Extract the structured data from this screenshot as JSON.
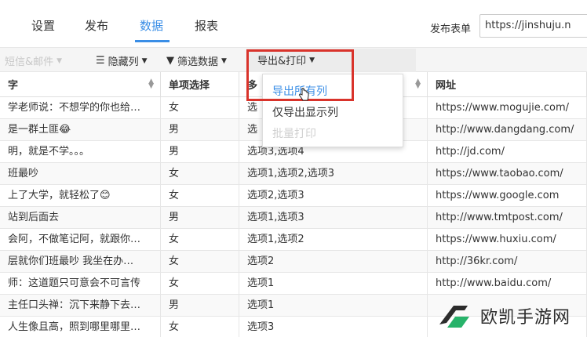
{
  "tabs": [
    {
      "label": "设置"
    },
    {
      "label": "发布"
    },
    {
      "label": "数据"
    },
    {
      "label": "报表"
    }
  ],
  "publish": {
    "label": "发布表单",
    "url": "https://jinshuju.n"
  },
  "toolbar": {
    "faded_label": "短信&邮件",
    "hide_columns": "隐藏列",
    "filter_data": "筛选数据",
    "export_print": "导出&打印"
  },
  "table": {
    "headers": [
      "字",
      "单项选择",
      "多",
      "网址"
    ],
    "rows": [
      [
        "学老师说：不想学的你也给…",
        "女",
        "选",
        "https://www.mogujie.com/"
      ],
      [
        "是一群土匪😂",
        "男",
        "选",
        "http://www.dangdang.com/"
      ],
      [
        "明，就是不学。。。",
        "男",
        "选项3,选项4",
        "http://jd.com/"
      ],
      [
        "班最吵",
        "女",
        "选项1,选项2,选项3",
        "https://www.taobao.com/"
      ],
      [
        "上了大学，就轻松了😊",
        "女",
        "选项2,选项3",
        "https://www.google.com"
      ],
      [
        "站到后面去",
        "男",
        "选项1,选项3",
        "http://www.tmtpost.com/"
      ],
      [
        "会阿，不做笔记阿，就跟你…",
        "女",
        "选项1,选项2",
        "https://www.huxiu.com/"
      ],
      [
        "层就你们班最吵 我坐在办…",
        "女",
        "选项2",
        "http://36kr.com/"
      ],
      [
        "师：这道题只可意会不可言传",
        "女",
        "选项1",
        "http://www.baidu.com/"
      ],
      [
        "主任口头禅：沉下来静下去…",
        "男",
        "选项1",
        ""
      ],
      [
        "人生像且高，照到哪里哪里…",
        "女",
        "选项3",
        ""
      ]
    ]
  },
  "dropdown": {
    "items": [
      {
        "label": "导出所有列"
      },
      {
        "label": "仅导出显示列"
      },
      {
        "label": "批量打印"
      }
    ]
  },
  "watermark": {
    "text": "欧凯手游网"
  },
  "colors": {
    "accent": "#3a8ee6",
    "highlight": "#d9332b"
  }
}
